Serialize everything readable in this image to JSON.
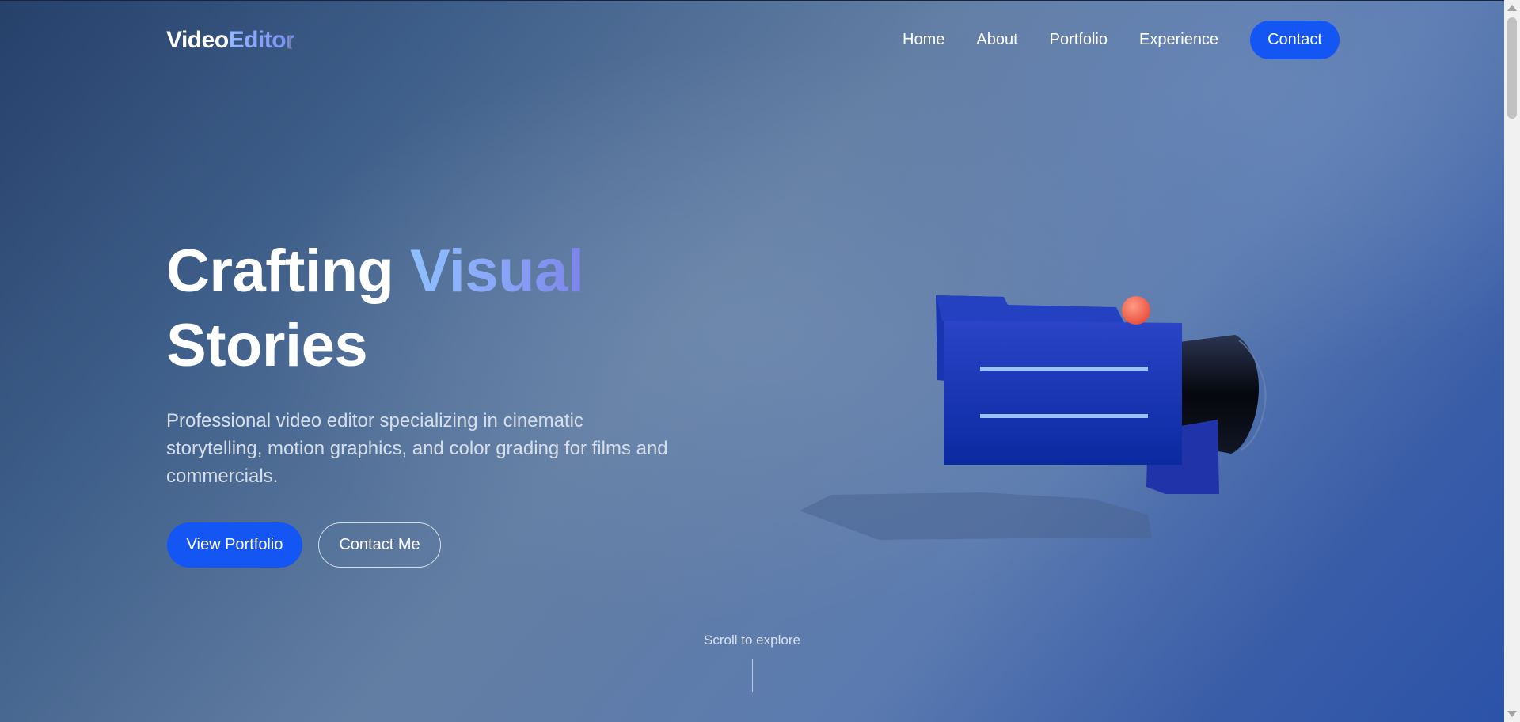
{
  "header": {
    "logo_main": "Video",
    "logo_accent": "Editor",
    "nav": {
      "home": "Home",
      "about": "About",
      "portfolio": "Portfolio",
      "experience": "Experience",
      "contact": "Contact"
    }
  },
  "hero": {
    "title_part1": "Crafting ",
    "title_accent": "Visual",
    "title_part2": "Stories",
    "subtitle": "Professional video editor specializing in cinematic storytelling, motion graphics, and color grading for films and commercials.",
    "primary_button": "View Portfolio",
    "secondary_button": "Contact Me"
  },
  "scroll_hint": "Scroll to explore",
  "colors": {
    "accent_blue": "#1456f4",
    "camera_body": "#1f3ec8",
    "record_light": "#f26a5a"
  }
}
